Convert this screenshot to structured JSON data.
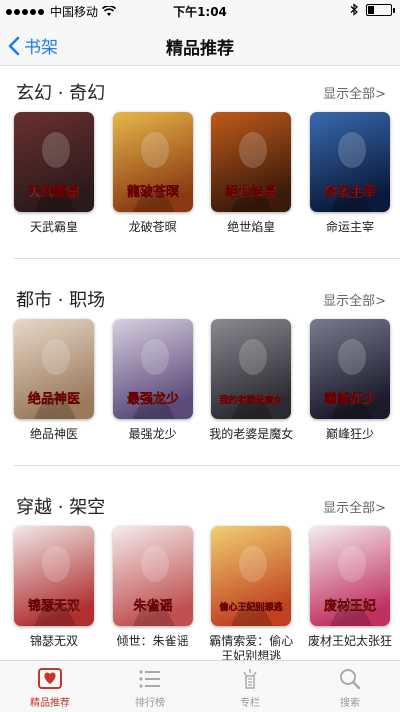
{
  "status_bar": {
    "carrier": "中国移动",
    "time": "下午1:04",
    "battery_level": 0.25
  },
  "nav": {
    "back_label": "书架",
    "title": "精品推荐"
  },
  "sections": [
    {
      "title": "玄幻 · 奇幻",
      "more": "显示全部>",
      "books": [
        {
          "title": "天武霸皇",
          "cover_text": "天武霸皇",
          "colors": [
            "#6a3030",
            "#2a1a1a"
          ]
        },
        {
          "title": "龙破苍暝",
          "cover_text": "龍破苍暝",
          "colors": [
            "#e8b84a",
            "#8a3a12"
          ]
        },
        {
          "title": "绝世焰皇",
          "cover_text": "絕世焰皇",
          "colors": [
            "#c05a1a",
            "#3a1a0a"
          ]
        },
        {
          "title": "命运主宰",
          "cover_text": "命运主宰",
          "colors": [
            "#3a6ab0",
            "#0a1a3a"
          ]
        }
      ]
    },
    {
      "title": "都市 · 职场",
      "more": "显示全部>",
      "books": [
        {
          "title": "绝品神医",
          "cover_text": "绝品神医",
          "colors": [
            "#e8d8c8",
            "#9a7a5a"
          ]
        },
        {
          "title": "最强龙少",
          "cover_text": "最强龙少",
          "colors": [
            "#d8d0e0",
            "#5a4a7a"
          ]
        },
        {
          "title": "我的老婆是魔女",
          "cover_text": "我的老婆是魔女",
          "colors": [
            "#8a8a90",
            "#2a2a30"
          ]
        },
        {
          "title": "巅峰狂少",
          "cover_text": "巅峰狂少",
          "colors": [
            "#7a7a90",
            "#1a1a2a"
          ]
        }
      ]
    },
    {
      "title": "穿越 · 架空",
      "more": "显示全部>",
      "books": [
        {
          "title": "锦瑟无双",
          "cover_text": "锦瑟无双",
          "colors": [
            "#f0e8e8",
            "#b03030"
          ]
        },
        {
          "title": "倾世：朱雀谣",
          "cover_text": "朱雀谣",
          "colors": [
            "#f4ecec",
            "#c05050"
          ]
        },
        {
          "title": "霸情索爱：偷心王妃别想逃",
          "cover_text": "偷心王妃别想逃",
          "colors": [
            "#f0d070",
            "#c04020"
          ]
        },
        {
          "title": "废材王妃太张狂",
          "cover_text": "废材王妃",
          "colors": [
            "#f4eef0",
            "#c03060"
          ]
        }
      ]
    }
  ],
  "tabs": [
    {
      "label": "精品推荐",
      "icon": "heart-book-icon",
      "active": true
    },
    {
      "label": "排行榜",
      "icon": "list-icon",
      "active": false
    },
    {
      "label": "专栏",
      "icon": "column-icon",
      "active": false
    },
    {
      "label": "搜索",
      "icon": "search-icon",
      "active": false
    }
  ],
  "accent_color": "#1a7cf2",
  "tab_active_color": "#c0392b"
}
